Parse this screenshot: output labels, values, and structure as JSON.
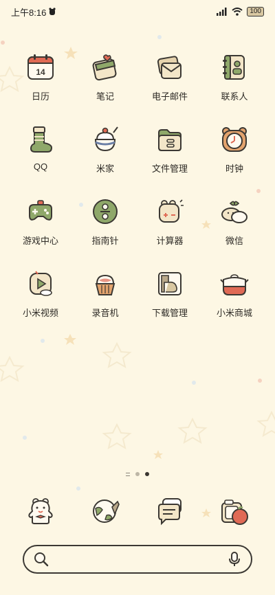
{
  "status_bar": {
    "time": "上午8:16",
    "battery": "100"
  },
  "apps": [
    {
      "label": "日历",
      "icon": "calendar-icon",
      "date": "14"
    },
    {
      "label": "笔记",
      "icon": "notes-icon"
    },
    {
      "label": "电子邮件",
      "icon": "email-icon"
    },
    {
      "label": "联系人",
      "icon": "contacts-icon"
    },
    {
      "label": "QQ",
      "icon": "qq-icon"
    },
    {
      "label": "米家",
      "icon": "mijia-icon"
    },
    {
      "label": "文件管理",
      "icon": "file-manager-icon"
    },
    {
      "label": "时钟",
      "icon": "clock-icon"
    },
    {
      "label": "游戏中心",
      "icon": "game-center-icon"
    },
    {
      "label": "指南针",
      "icon": "compass-icon"
    },
    {
      "label": "计算器",
      "icon": "calculator-icon"
    },
    {
      "label": "微信",
      "icon": "wechat-icon"
    },
    {
      "label": "小米视频",
      "icon": "mi-video-icon"
    },
    {
      "label": "录音机",
      "icon": "recorder-icon"
    },
    {
      "label": "下载管理",
      "icon": "downloads-icon"
    },
    {
      "label": "小米商城",
      "icon": "mi-store-icon"
    }
  ],
  "dock": [
    {
      "icon": "phone-icon"
    },
    {
      "icon": "browser-icon"
    },
    {
      "icon": "messages-icon"
    },
    {
      "icon": "camera-icon"
    }
  ],
  "pager": {
    "pages": 3,
    "active": 2
  },
  "colors": {
    "background": "#fdf7e4",
    "accent_green": "#8fa86a",
    "outline": "#3b3833",
    "tile_cream": "#f3e6c8",
    "tile_red": "#e06a55"
  }
}
